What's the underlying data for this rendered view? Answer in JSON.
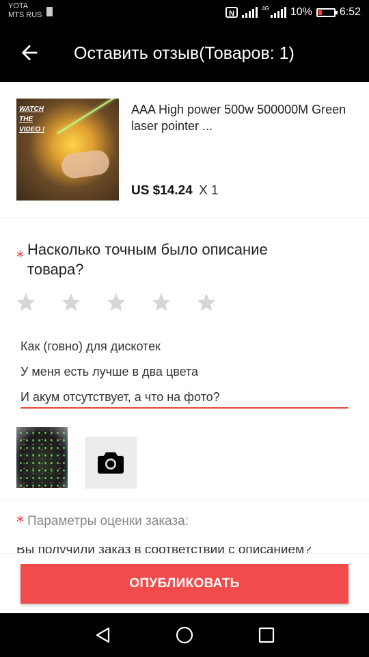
{
  "status_bar": {
    "carrier_line1": "YOTA",
    "carrier_line2": "MTS RUS",
    "nfc_label": "N",
    "network_type": "4G",
    "battery_text": "10%",
    "time": "6:52",
    "battery_color": "#ff3b30"
  },
  "app_bar": {
    "back_icon": "arrow-left-icon",
    "title": "Оставить отзыв(Товаров: 1)"
  },
  "product": {
    "image_caption": "WATCH\nTHE\nVIDEO !",
    "name": "AAA High power 500w 500000M Green laser pointer ...",
    "price": "US $14.24",
    "quantity": "X 1"
  },
  "question": {
    "required_mark": "*",
    "text": "Насколько точным было описание товара?",
    "rating_stars": 5,
    "selected_stars": 0
  },
  "review_text": {
    "line1": "Как (говно) для дискотек",
    "line2": "У меня есть лучше в два цвета",
    "line3": "И акум отсутствует, а что на фото?"
  },
  "photos": {
    "add_icon": "camera-icon"
  },
  "parameters": {
    "required_mark": "*",
    "label": "Параметры оценки заказа:",
    "next_row_text": "Вы получили заказ в соответствии с описанием?"
  },
  "footer": {
    "publish_label": "ОПУБЛИКОВАТЬ",
    "accent_color": "#f14b4b"
  },
  "nav_bar": {
    "back": "triangle-back-icon",
    "home": "circle-home-icon",
    "recents": "square-recents-icon"
  }
}
